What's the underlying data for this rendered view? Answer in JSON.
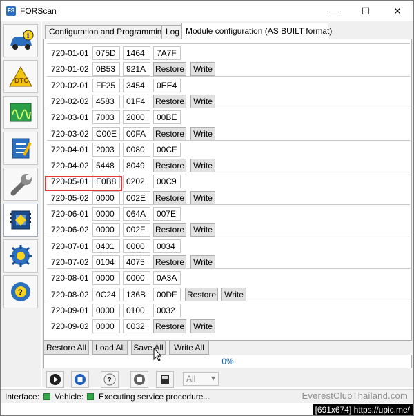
{
  "window": {
    "title": "FORScan",
    "controls": [
      "—",
      "☐",
      "✕"
    ]
  },
  "tabs": [
    {
      "label": "Configuration and Programming"
    },
    {
      "label": "Log"
    },
    {
      "label": "Module configuration (AS BUILT format)"
    }
  ],
  "rows": [
    {
      "addr": "720-01-01",
      "v1": "075D",
      "v2": "1464",
      "v3": "7A7F"
    },
    {
      "addr": "720-01-02",
      "v1": "0B53",
      "v2": "921A",
      "restore": "Restore",
      "write": "Write"
    },
    {
      "addr": "720-02-01",
      "v1": "FF25",
      "v2": "3454",
      "v3": "0EE4"
    },
    {
      "addr": "720-02-02",
      "v1": "4583",
      "v2": "01F4",
      "restore": "Restore",
      "write": "Write"
    },
    {
      "addr": "720-03-01",
      "v1": "7003",
      "v2": "2000",
      "v3": "00BE"
    },
    {
      "addr": "720-03-02",
      "v1": "C00E",
      "v2": "00FA",
      "restore": "Restore",
      "write": "Write"
    },
    {
      "addr": "720-04-01",
      "v1": "2003",
      "v2": "0080",
      "v3": "00CF"
    },
    {
      "addr": "720-04-02",
      "v1": "5448",
      "v2": "8049",
      "restore": "Restore",
      "write": "Write"
    },
    {
      "addr": "720-05-01",
      "v1": "E0B8",
      "v2": "0202",
      "v3": "00C9"
    },
    {
      "addr": "720-05-02",
      "v1": "0000",
      "v2": "002E",
      "restore": "Restore",
      "write": "Write"
    },
    {
      "addr": "720-06-01",
      "v1": "0000",
      "v2": "064A",
      "v3": "007E"
    },
    {
      "addr": "720-06-02",
      "v1": "0000",
      "v2": "002F",
      "restore": "Restore",
      "write": "Write"
    },
    {
      "addr": "720-07-01",
      "v1": "0401",
      "v2": "0000",
      "v3": "0034"
    },
    {
      "addr": "720-07-02",
      "v1": "0104",
      "v2": "4075",
      "restore": "Restore",
      "write": "Write"
    },
    {
      "addr": "720-08-01",
      "v1": "0000",
      "v2": "0000",
      "v3": "0A3A"
    },
    {
      "addr": "720-08-02",
      "v1": "0C24",
      "v2": "136B",
      "v3": "00DF",
      "restore": "Restore",
      "write": "Write"
    },
    {
      "addr": "720-09-01",
      "v1": "0000",
      "v2": "0100",
      "v3": "0032"
    },
    {
      "addr": "720-09-02",
      "v1": "0000",
      "v2": "0032",
      "restore": "Restore",
      "write": "Write"
    }
  ],
  "actions": {
    "restore_all": "Restore All",
    "load_all": "Load All",
    "save_all": "Save All",
    "write_all": "Write All"
  },
  "progress": {
    "text": "0%",
    "value": 0
  },
  "toolbar": {
    "icons": [
      "play-icon",
      "stop-icon",
      "help-icon",
      "erase-icon",
      "save-icon"
    ],
    "filter_value": "All"
  },
  "status": {
    "interface_label": "Interface:",
    "vehicle_label": "Vehicle:",
    "message": "Executing service procedure..."
  },
  "watermark": "EverestClubThailand.com",
  "footer": "[691x674] https://upic.me/",
  "colors": {
    "accent": "#2d6fbf",
    "highlight": "#e53935",
    "led_green": "#35a84a",
    "progress_text": "#0060c0"
  }
}
